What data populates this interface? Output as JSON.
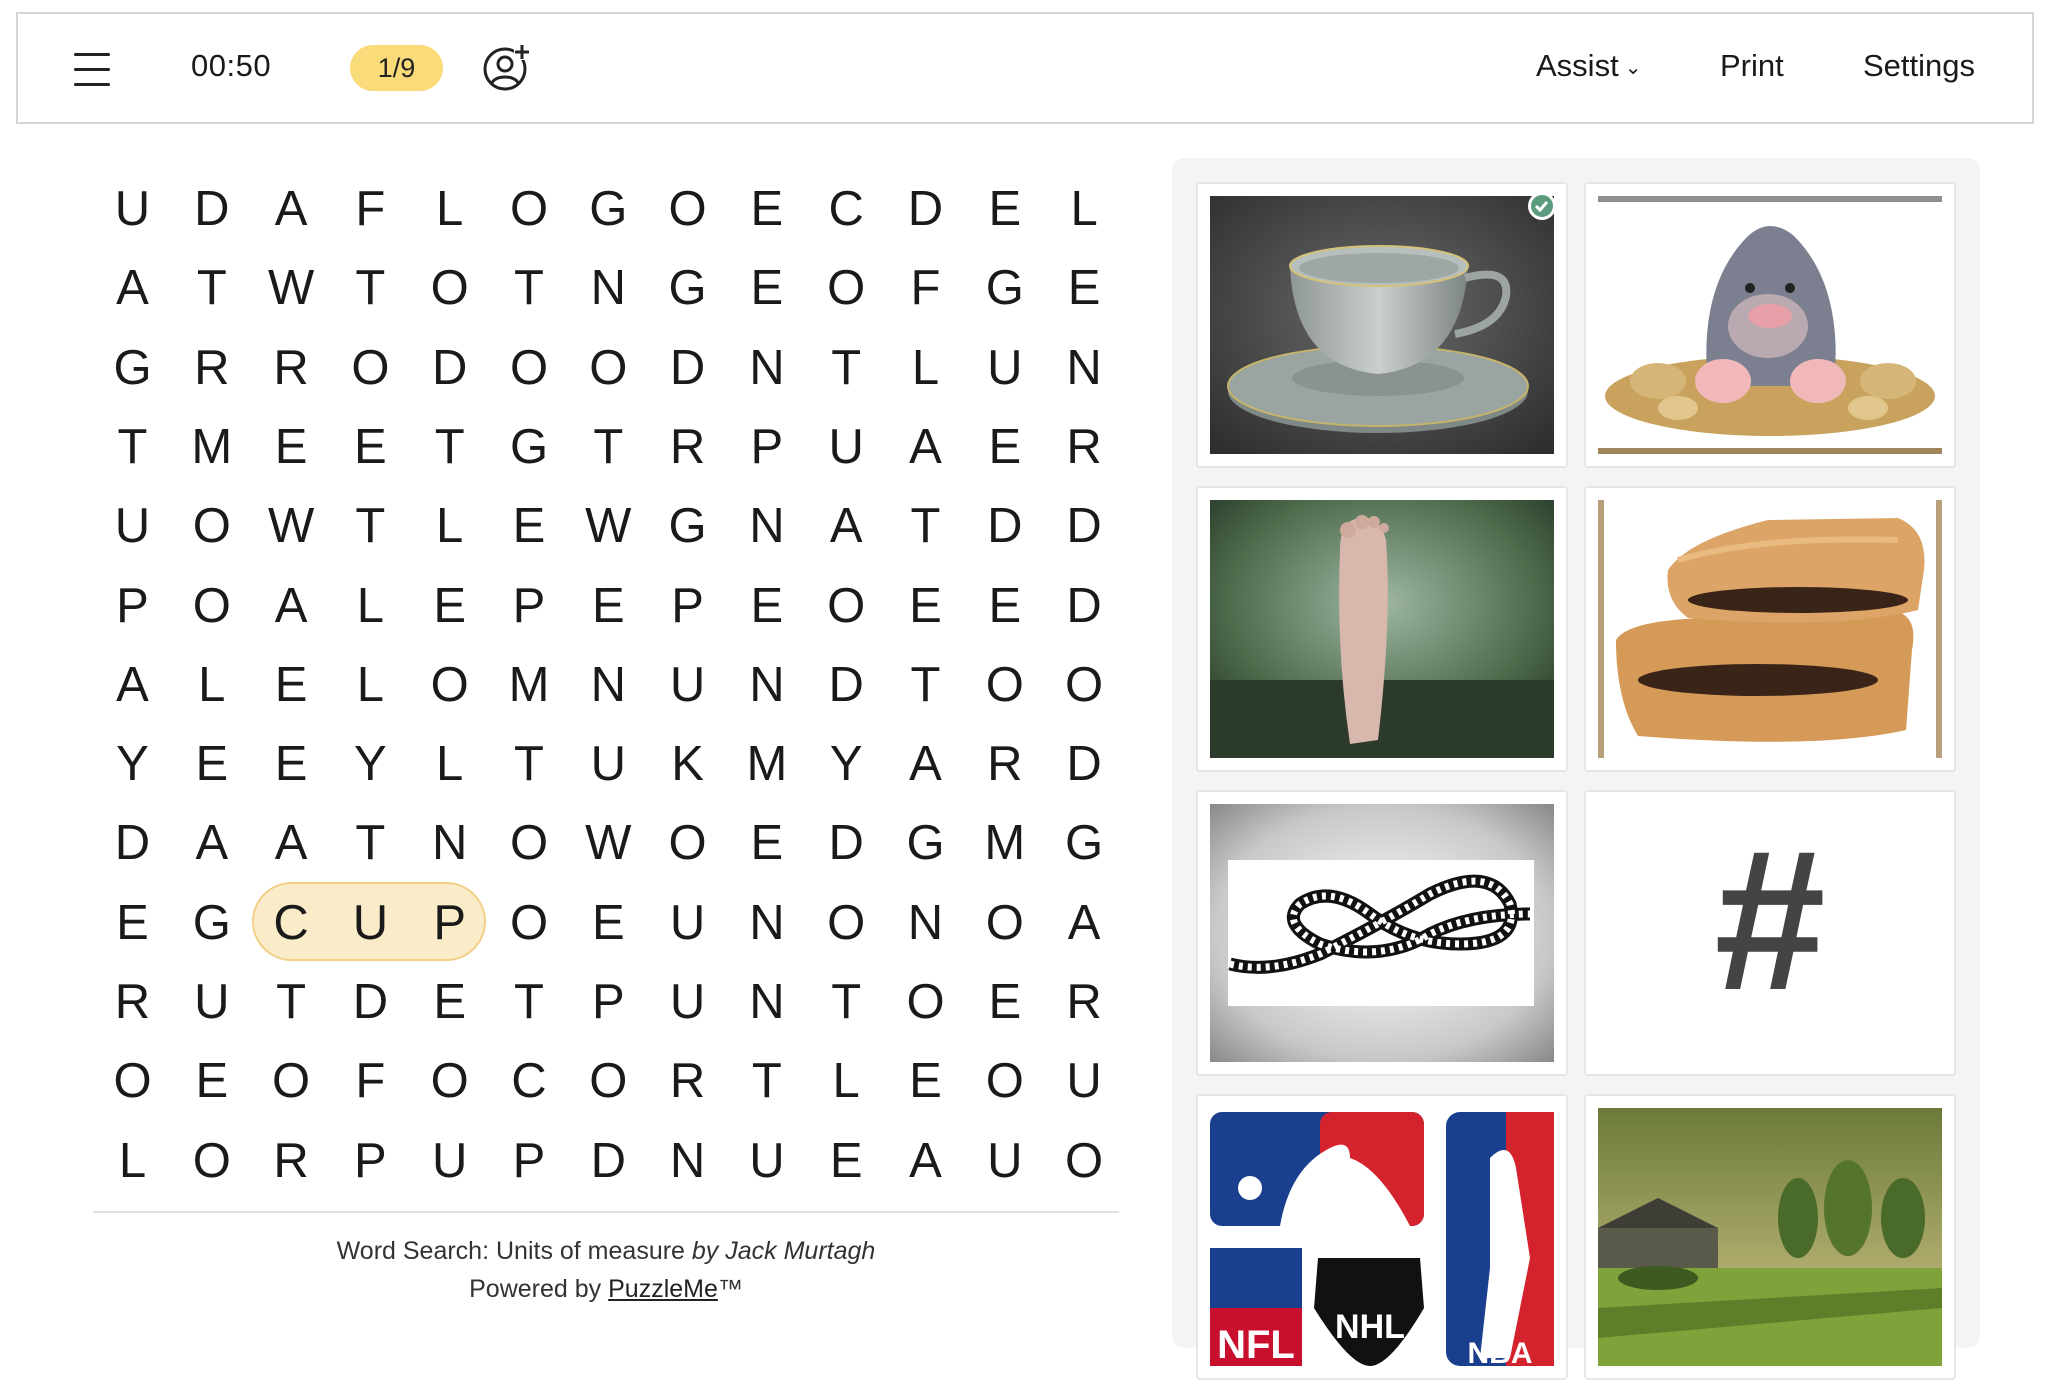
{
  "header": {
    "timer": "00:50",
    "progress": "1/9",
    "assist_label": "Assist",
    "print_label": "Print",
    "settings_label": "Settings"
  },
  "grid": [
    "UDAFLOGOECDEL",
    "ATWTOTNGEOFGE",
    "GRRODOODNTLUN",
    "TMEETGTRPUAER",
    "UOWTLEWGNATDD",
    "POALEPEPEOEED",
    "ALELOMNUNDTOO",
    "YEEYLTUKMYARD",
    "DAATNOWOEDGMG",
    "EGCUPOEUNONOA",
    "RUTDETPUNTOER",
    "OEOFOCORTLEOU",
    "LORPUPDNUEAUO"
  ],
  "found_word": "CUP",
  "credit": {
    "title": "Word Search: Units of measure",
    "by": "by Jack Murtagh",
    "powered_prefix": "Powered by",
    "powered_link": "PuzzleMe",
    "trademark": "™"
  },
  "images": [
    {
      "name": "teacup",
      "found": true
    },
    {
      "name": "mole",
      "found": false
    },
    {
      "name": "foot",
      "found": false
    },
    {
      "name": "fig-bar",
      "found": false
    },
    {
      "name": "knot",
      "found": false
    },
    {
      "name": "hash-sign",
      "found": false
    },
    {
      "name": "sports-league-logos",
      "found": false
    },
    {
      "name": "yard",
      "found": false
    }
  ],
  "logo_text": {
    "nfl": "NFL",
    "nhl": "NHL",
    "nba": "NBA"
  },
  "hash_symbol": "#",
  "colors": {
    "highlight": "#fbecc9",
    "progress_pill": "#f9dc79",
    "check": "#5a9b7e"
  }
}
